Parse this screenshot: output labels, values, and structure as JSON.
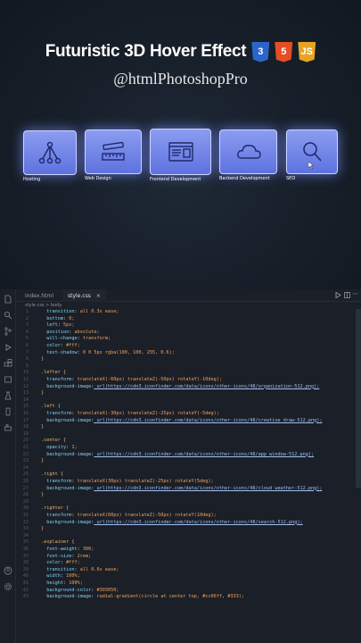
{
  "hero": {
    "title": "Futuristic 3D Hover Effect",
    "badges": {
      "css": "3",
      "html": "5",
      "js": "JS"
    },
    "handle": "@htmlPhotoshopPro"
  },
  "cards": [
    {
      "label": "Hosting",
      "icon": "organization-icon"
    },
    {
      "label": "Web Design",
      "icon": "creative-draw-icon"
    },
    {
      "label": "Frontend Development",
      "icon": "app-window-icon"
    },
    {
      "label": "Backend Development",
      "icon": "cloud-icon"
    },
    {
      "label": "SEO",
      "icon": "search-icon"
    }
  ],
  "editor": {
    "tabs": [
      {
        "label": "index.html"
      },
      {
        "label": "style.css",
        "close": "×"
      }
    ],
    "breadcrumb": "style.css > body",
    "start_line": 1,
    "lines": [
      "  transition: all 0.3s ease;",
      "  bottom: 0;",
      "  left: 5px;",
      "  position: absolute;",
      "  will-change: transform;",
      "  color: #fff;",
      "  text-shadow: 0 0 5px rgba(100, 100, 255, 0.6);",
      "}",
      "",
      ".lefter {",
      "  transform: translateX(-60px) translateZ(-50px) rotateY(-10deg);",
      "  background-image: url(https://cdn3.iconfinder.com/data/icons/other-icons/48/organization-512.png);",
      "}",
      "",
      ".left {",
      "  transform: translateX(-30px) translateZ(-25px) rotateY(-5deg);",
      "  background-image: url(https://cdn3.iconfinder.com/data/icons/other-icons/48/creative_draw-512.png);",
      "}",
      "",
      ".center {",
      "  opacity: 1;",
      "  background-image: url(https://cdn3.iconfinder.com/data/icons/other-icons/48/app_window-512.png);",
      "}",
      "",
      ".right {",
      "  transform: translateX(30px) translateZ(-25px) rotateY(5deg);",
      "  background-image: url(https://cdn3.iconfinder.com/data/icons/other-icons/48/cloud_weather-512.png);",
      "}",
      "",
      ".righter {",
      "  transform: translateX(60px) translateZ(-50px) rotateY(10deg);",
      "  background-image: url(https://cdn3.iconfinder.com/data/icons/other-icons/48/search-512.png);",
      "}",
      "",
      ".explainer {",
      "  font-weight: 300;",
      "  font-size: 2rem;",
      "  color: #fff;",
      "  transition: all 0.6s ease;",
      "  width: 100%;",
      "  height: 100%;",
      "  background-color: #303050;",
      "  background-image: radial-gradient(circle at center top, #cc66ff, #333);"
    ]
  },
  "colors": {
    "card": "#6b7fe6",
    "glow": "#8a9cff",
    "editor_bg": "#1b1f27"
  }
}
